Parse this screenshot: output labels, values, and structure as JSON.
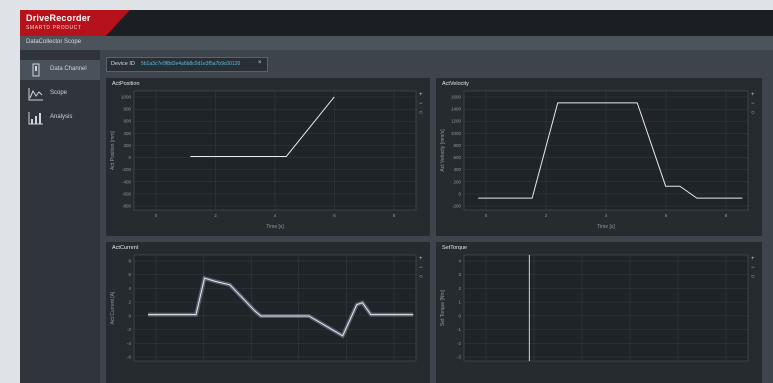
{
  "brand": {
    "name": "DriveRecorder",
    "subtitle": "SMARTD PRODUCT"
  },
  "window": {
    "title": "DataCollector Scope"
  },
  "sidebar": {
    "items": [
      {
        "label": "Data Channel",
        "icon": "data-channel-icon",
        "active": true
      },
      {
        "label": "Scope",
        "icon": "scope-icon",
        "active": false
      },
      {
        "label": "Analysis",
        "icon": "analysis-icon",
        "active": false
      }
    ]
  },
  "device": {
    "label": "Device ID",
    "value": "5b1a3c7e9f8d2e4a6b8c0d1e3f5a7b9c00120",
    "close_glyph": "×"
  },
  "panels": [
    {
      "title": "ActPosition",
      "xlabel": "Time [s]",
      "ylabel": "Act Position [mm]",
      "xticks": [
        "0",
        "2",
        "4",
        "6",
        "8"
      ],
      "yticks": [
        "1000",
        "800",
        "600",
        "400",
        "200",
        "0",
        "-200",
        "-400",
        "-600",
        "-800"
      ]
    },
    {
      "title": "ActVelocity",
      "xlabel": "Time [s]",
      "ylabel": "Act Velocity [mm/s]",
      "xticks": [
        "0",
        "2",
        "4",
        "6",
        "8"
      ],
      "yticks": [
        "1600",
        "1400",
        "1200",
        "1000",
        "800",
        "600",
        "400",
        "200",
        "0",
        "-200"
      ]
    },
    {
      "title": "ActCurrent",
      "ylabel": "Act Current [A]",
      "yticks": [
        "8",
        "6",
        "4",
        "2",
        "0",
        "-2",
        "-4",
        "-6"
      ]
    },
    {
      "title": "SetTorque",
      "ylabel": "Set Torque [Nm]",
      "yticks": [
        "4",
        "3",
        "2",
        "1",
        "0",
        "-1",
        "-2",
        "-3"
      ]
    }
  ],
  "tools": [
    "zoom-in-icon",
    "zoom-out-icon",
    "reset-icon"
  ],
  "chart_data": [
    {
      "type": "line",
      "title": "ActPosition",
      "xlabel": "Time [s]",
      "ylabel": "Act Position [mm]",
      "xlim": [
        -1,
        9
      ],
      "ylim": [
        -900,
        1100
      ],
      "series": [
        {
          "x": [
            1,
            4.4,
            6.1
          ],
          "y": [
            0,
            0,
            1000
          ]
        }
      ]
    },
    {
      "type": "line",
      "title": "ActVelocity",
      "xlabel": "Time [s]",
      "ylabel": "Act Velocity [mm/s]",
      "xlim": [
        -1,
        9
      ],
      "ylim": [
        -300,
        1700
      ],
      "series": [
        {
          "x": [
            -0.5,
            1.4,
            2.3,
            5.1,
            6.1,
            6.6,
            7.2,
            8.8
          ],
          "y": [
            -100,
            -100,
            1500,
            1500,
            100,
            100,
            -100,
            -100
          ]
        }
      ]
    },
    {
      "type": "line",
      "title": "ActCurrent",
      "ylabel": "Act Current [A]",
      "xlim": [
        -1,
        9
      ],
      "ylim": [
        -7,
        9
      ],
      "series": [
        {
          "x": [
            -0.5,
            1.2,
            1.5,
            1.9,
            2.4,
            3.3,
            3.5,
            5.2,
            6.4,
            6.9,
            7.1,
            7.4,
            8.9
          ],
          "y": [
            0,
            0,
            5.5,
            5,
            4.5,
            0.5,
            -0.2,
            -0.2,
            -3.2,
            1.5,
            1.8,
            0,
            0
          ]
        }
      ]
    },
    {
      "type": "line",
      "title": "SetTorque",
      "ylabel": "Set Torque [Nm]",
      "xlim": [
        -1,
        9
      ],
      "ylim": [
        -3.5,
        4.5
      ],
      "series": [
        {
          "x": [],
          "y": []
        }
      ]
    }
  ]
}
